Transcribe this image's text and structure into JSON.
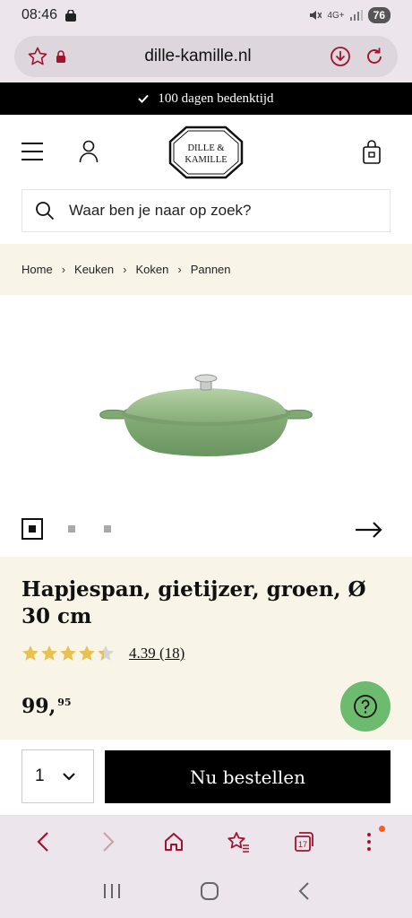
{
  "status_bar": {
    "time": "08:46",
    "network": "4G+",
    "battery": "76"
  },
  "browser": {
    "url": "dille-kamille.nl"
  },
  "banner": {
    "text": "100 dagen bedenktijd"
  },
  "logo": {
    "line1": "DILLE &",
    "line2": "KAMILLE"
  },
  "search": {
    "placeholder": "Waar ben je naar op zoek?"
  },
  "breadcrumb": [
    "Home",
    "Keuken",
    "Koken",
    "Pannen"
  ],
  "product": {
    "title": "Hapjespan, gietijzer, groen, Ø 30 cm",
    "rating": 4.39,
    "rating_label": "4.39 (18)",
    "price_main": "99,",
    "price_cents": "95",
    "image_count": 3
  },
  "order": {
    "quantity": "1",
    "button_label": "Nu bestellen"
  },
  "icons": {
    "menu": "hamburger-icon",
    "user": "user-icon",
    "cart": "shopping-bag-icon",
    "search": "search-icon",
    "next": "arrow-right-icon",
    "help": "question-icon"
  },
  "colors": {
    "banner_bg": "#000000",
    "cream": "#f8f5e8",
    "pan_green": "#7fa873",
    "help_green": "#6dbb6e",
    "browser_accent": "#a3122f"
  }
}
